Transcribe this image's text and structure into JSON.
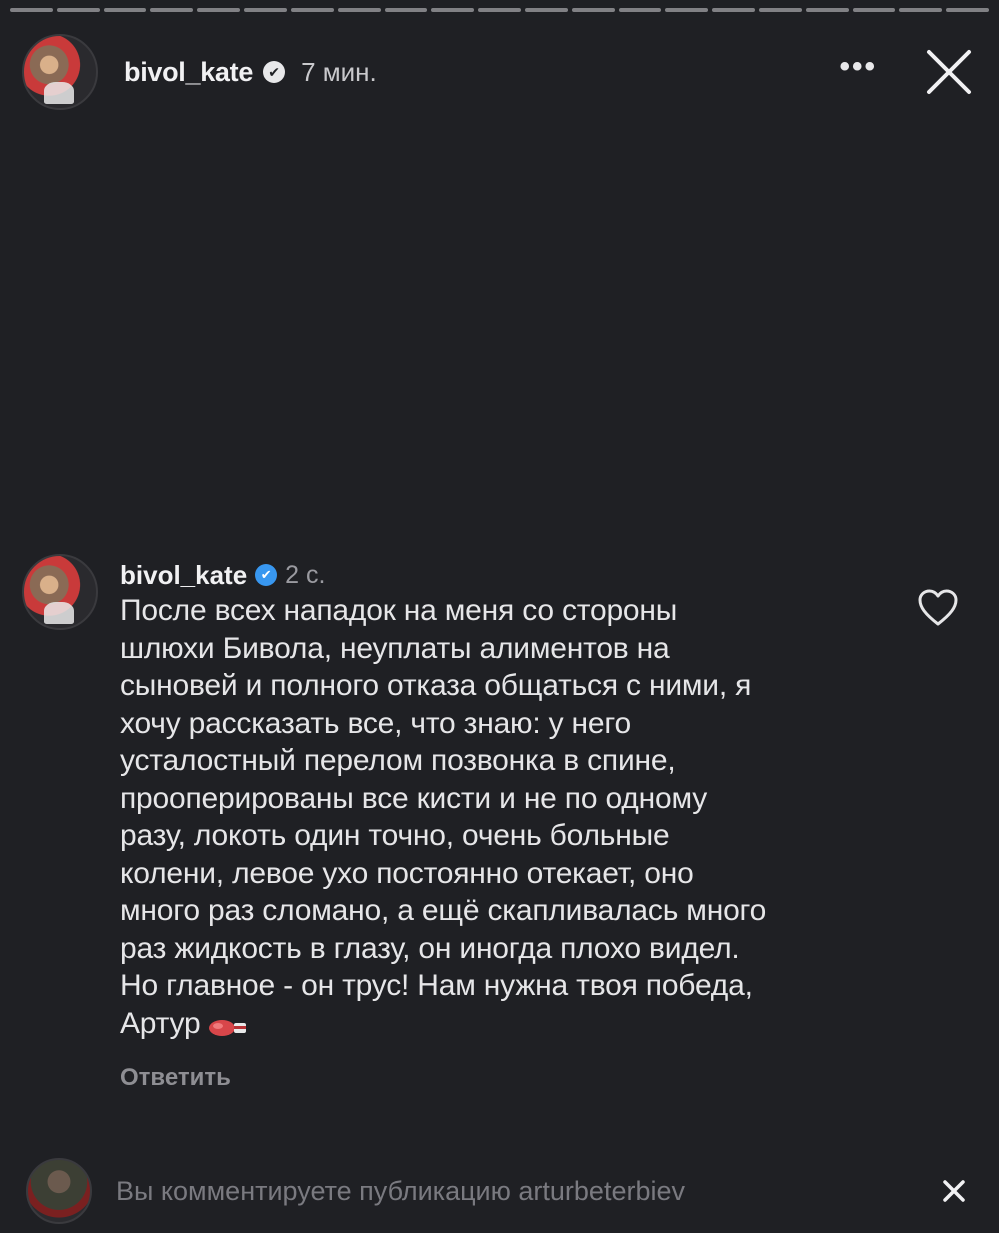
{
  "story": {
    "progress_segments": 21,
    "header": {
      "username": "bivol_kate",
      "verified_mark": "✔",
      "time": "7 мин.",
      "more_label": "•••"
    }
  },
  "comment": {
    "username": "bivol_kate",
    "verified_mark": "✔",
    "time": "2 с.",
    "text": "После всех нападок на меня со стороны\nшлюхи Бивола, неуплаты алиментов на\nсыновей и полного отказа общаться с ними, я\nхочу рассказать все, что знаю: у него\nусталостный перелом позвонка в спине,\nпрооперированы все кисти и не по одному\nразу, локоть один точно, очень больные\nколени, левое ухо постоянно отекает, оно\nмного раз сломано, а ещё скапливалась много\nраз жидкость в глазу, он иногда плохо видел.\nНо главное - он трус! Нам нужна твоя победа,\nАртур",
    "emoji": "boxing-glove-icon",
    "reply_label": "Ответить"
  },
  "bottom_bar": {
    "text": "Вы комментируете публикацию arturbeterbiev",
    "close_label": "×"
  },
  "colors": {
    "background": "#1f2024",
    "verified_blue": "#3897f0",
    "muted_text": "#7a7a80"
  }
}
